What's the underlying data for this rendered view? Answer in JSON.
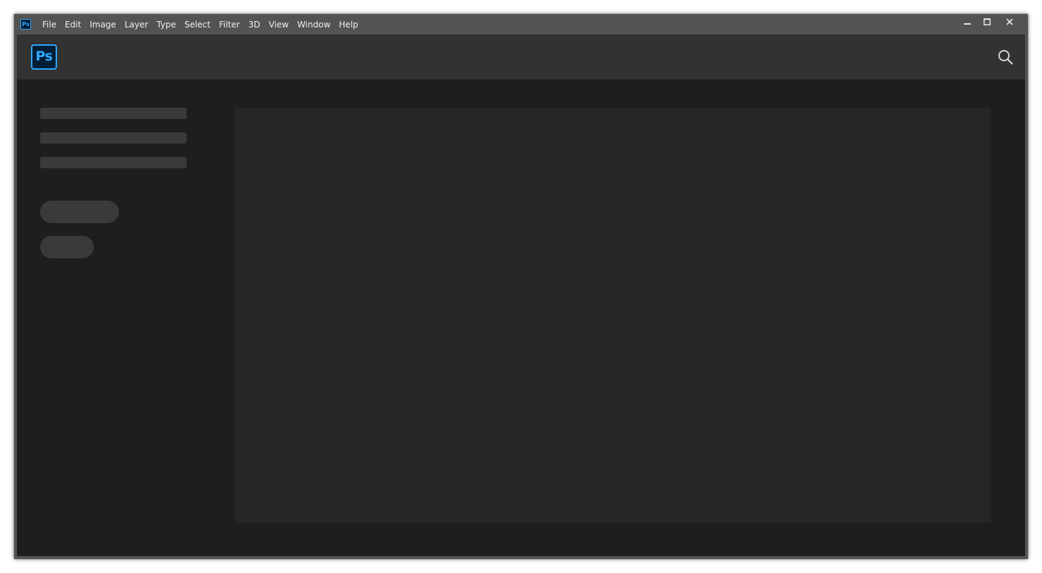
{
  "titlebar": {
    "app_icon_text": "Ps",
    "menu": [
      "File",
      "Edit",
      "Image",
      "Layer",
      "Type",
      "Select",
      "Filter",
      "3D",
      "View",
      "Window",
      "Help"
    ]
  },
  "header": {
    "logo_text": "Ps"
  },
  "icons": {
    "app": "photoshop-app-icon",
    "logo": "photoshop-logo",
    "search": "search-icon",
    "minimize": "minimize-icon",
    "maximize": "maximize-icon",
    "close": "close-icon"
  },
  "colors": {
    "brand_blue": "#31a8ff",
    "brand_dark": "#001e36",
    "titlebar": "#535353",
    "header": "#323232",
    "content_bg": "#1e1e1e",
    "panel_bg": "#262626",
    "skeleton": "#3a3a3a"
  }
}
